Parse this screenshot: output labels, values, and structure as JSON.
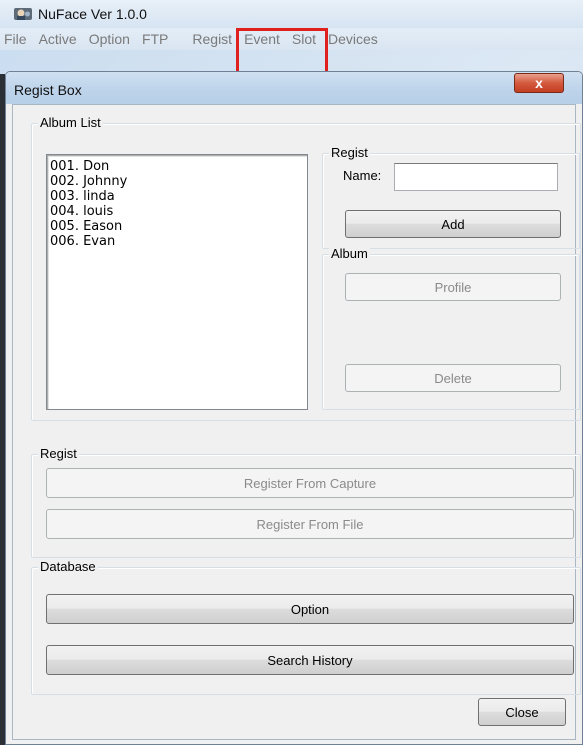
{
  "app": {
    "title": "NuFace Ver 1.0.0"
  },
  "menubar": {
    "items": [
      "File",
      "Active",
      "Option",
      "FTP",
      "Regist",
      "Event",
      "Slot",
      "Devices"
    ]
  },
  "dialog": {
    "title": "Regist Box",
    "close_glyph": "x"
  },
  "album_list": {
    "label": "Album List",
    "items": [
      "001. Don",
      "002. Johnny",
      "003. linda",
      "004. louis",
      "005. Eason",
      "006. Evan"
    ]
  },
  "regist_panel": {
    "label": "Regist",
    "name_label": "Name:",
    "name_value": "",
    "add_label": "Add"
  },
  "album_panel": {
    "label": "Album",
    "profile_label": "Profile",
    "delete_label": "Delete"
  },
  "regist_group": {
    "label": "Regist",
    "capture_label": "Register From Capture",
    "file_label": "Register From File"
  },
  "database_group": {
    "label": "Database",
    "option_label": "Option",
    "history_label": "Search History"
  },
  "footer": {
    "close_label": "Close"
  },
  "colors": {
    "highlight": "#e0201c",
    "dialog_bg": "#f0f0f0",
    "close_button": "#c23e22"
  }
}
